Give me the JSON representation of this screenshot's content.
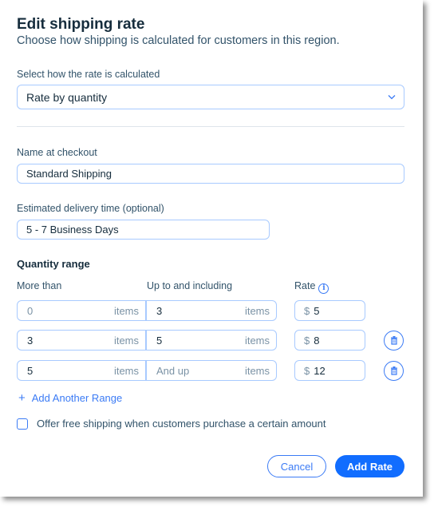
{
  "dialog": {
    "title": "Edit shipping rate",
    "subtitle": "Choose how shipping is calculated for customers in this region."
  },
  "calculation": {
    "label": "Select how the rate is calculated",
    "selected": "Rate by quantity",
    "icon": "chevron-down-icon"
  },
  "checkout_name": {
    "label": "Name at checkout",
    "value": "Standard Shipping"
  },
  "delivery_time": {
    "label": "Estimated delivery time (optional)",
    "value": "5 - 7 Business Days"
  },
  "quantity_range": {
    "section_title": "Quantity range",
    "headers": {
      "more_than": "More than",
      "up_to": "Up to and including",
      "rate": "Rate",
      "rate_info_icon": "info-icon"
    },
    "unit": "items",
    "currency": "$",
    "rows": [
      {
        "more_than": "0",
        "more_than_placeholder": true,
        "up_to": "3",
        "up_to_placeholder": false,
        "rate": "5",
        "deletable": false
      },
      {
        "more_than": "3",
        "more_than_placeholder": false,
        "up_to": "5",
        "up_to_placeholder": false,
        "rate": "8",
        "deletable": true
      },
      {
        "more_than": "5",
        "more_than_placeholder": false,
        "up_to": "And up",
        "up_to_placeholder": true,
        "rate": "12",
        "deletable": true
      }
    ],
    "add_range": "Add Another Range"
  },
  "free_shipping": {
    "label": "Offer free shipping when customers purchase a certain amount",
    "checked": false
  },
  "buttons": {
    "cancel": "Cancel",
    "submit": "Add Rate"
  },
  "colors": {
    "accent": "#116DFF",
    "link": "#3B7BF5",
    "border": "#A8CAFF",
    "text": "#162D3D"
  }
}
